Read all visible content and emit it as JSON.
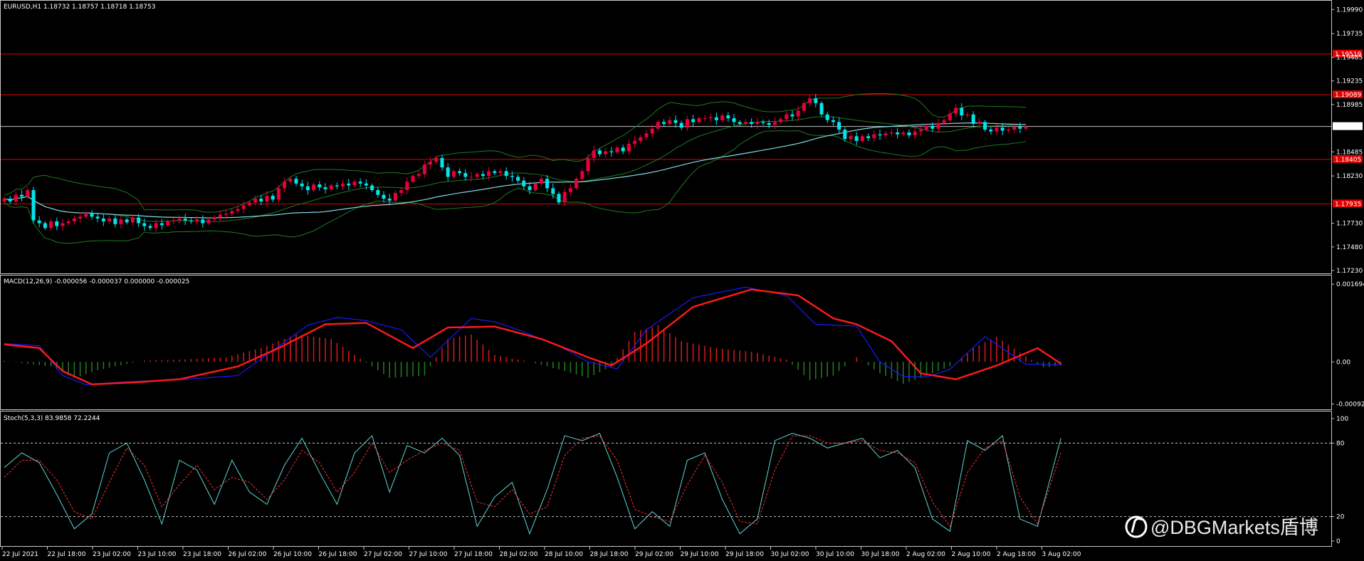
{
  "symbol_header": "EURUSD,H1  1.18732 1.18757 1.18718 1.18753",
  "watermark": "@DBGMarkets盾博",
  "colors": {
    "background": "#000000",
    "frame": "#c8c8c8",
    "bull_candle": "#e8003d",
    "bear_candle": "#00e5ee",
    "bollinger": "#1f7a1f",
    "moving_average": "#7fdbe8",
    "level_line": "#e00000",
    "bid_line": "#c0c0c0",
    "macd_line": "#1a1aff",
    "signal_line": "#ff1a1a",
    "hist_pos": "#cc1a1a",
    "hist_neg": "#1f7a1f",
    "stoch_main": "#5fd5d5",
    "stoch_signal": "#ff3030"
  },
  "chart_data": [
    {
      "type": "candlestick",
      "title": "EURUSD,H1  1.18732 1.18757 1.18718 1.18753",
      "price_ticks": [
        "1.19990",
        "1.19735",
        "1.19485",
        "1.19235",
        "1.18985",
        "1.18485",
        "1.18230",
        "1.17730",
        "1.17480",
        "1.17230"
      ],
      "y_range": [
        1.1723,
        1.2006
      ],
      "current_price": "1.18753",
      "level_labels": [
        "1.19519",
        "1.19089",
        "1.18405",
        "1.17935"
      ],
      "levels": [
        1.19519,
        1.19089,
        1.18405,
        1.17935
      ],
      "closes": [
        1.1799,
        1.1796,
        1.1803,
        1.1801,
        1.1808,
        1.1776,
        1.1773,
        1.1768,
        1.1775,
        1.177,
        1.1773,
        1.1775,
        1.1778,
        1.178,
        1.1784,
        1.178,
        1.1778,
        1.1775,
        1.1778,
        1.1772,
        1.1777,
        1.1774,
        1.1779,
        1.1773,
        1.177,
        1.1768,
        1.1773,
        1.1771,
        1.1775,
        1.1776,
        1.1778,
        1.1776,
        1.1775,
        1.1777,
        1.1773,
        1.1777,
        1.1779,
        1.1782,
        1.1783,
        1.1786,
        1.1788,
        1.1792,
        1.1795,
        1.1799,
        1.1796,
        1.1802,
        1.1798,
        1.181,
        1.1817,
        1.182,
        1.1815,
        1.1812,
        1.1808,
        1.1814,
        1.1811,
        1.1809,
        1.1813,
        1.1812,
        1.1815,
        1.1813,
        1.1817,
        1.1815,
        1.1813,
        1.1808,
        1.1803,
        1.1799,
        1.1797,
        1.1805,
        1.1808,
        1.1817,
        1.1823,
        1.1825,
        1.1835,
        1.1838,
        1.1842,
        1.1832,
        1.1822,
        1.1828,
        1.1826,
        1.1822,
        1.1822,
        1.1825,
        1.1823,
        1.1828,
        1.1826,
        1.1828,
        1.1823,
        1.1822,
        1.1818,
        1.1812,
        1.1808,
        1.1815,
        1.182,
        1.181,
        1.1804,
        1.1795,
        1.1806,
        1.181,
        1.182,
        1.1828,
        1.1842,
        1.185,
        1.1846,
        1.1849,
        1.1848,
        1.1853,
        1.1849,
        1.1857,
        1.186,
        1.1864,
        1.1868,
        1.1873,
        1.188,
        1.1878,
        1.1882,
        1.1879,
        1.1874,
        1.1883,
        1.188,
        1.1884,
        1.1884,
        1.1885,
        1.1882,
        1.1887,
        1.1884,
        1.188,
        1.1878,
        1.188,
        1.1878,
        1.188,
        1.1879,
        1.1877,
        1.188,
        1.1883,
        1.1888,
        1.1886,
        1.1892,
        1.19,
        1.1905,
        1.19,
        1.1888,
        1.1882,
        1.188,
        1.1872,
        1.1862,
        1.1865,
        1.186,
        1.1865,
        1.1863,
        1.1867,
        1.1866,
        1.1868,
        1.1869,
        1.1867,
        1.1869,
        1.1866,
        1.187,
        1.1872,
        1.1876,
        1.1873,
        1.1879,
        1.1882,
        1.1889,
        1.1895,
        1.1887,
        1.1888,
        1.1878,
        1.188,
        1.1872,
        1.187,
        1.1874,
        1.1871,
        1.1872,
        1.1875,
        1.1873,
        1.18753
      ],
      "x_ticks": [
        "22 Jul 2021",
        "22 Jul 18:00",
        "23 Jul 02:00",
        "23 Jul 10:00",
        "23 Jul 18:00",
        "26 Jul 02:00",
        "26 Jul 10:00",
        "26 Jul 18:00",
        "27 Jul 02:00",
        "27 Jul 10:00",
        "27 Jul 18:00",
        "28 Jul 02:00",
        "28 Jul 10:00",
        "28 Jul 18:00",
        "29 Jul 02:00",
        "29 Jul 10:00",
        "29 Jul 18:00",
        "30 Jul 02:00",
        "30 Jul 10:00",
        "30 Jul 18:00",
        "2 Aug 02:00",
        "2 Aug 10:00",
        "2 Aug 18:00",
        "3 Aug 02:00"
      ]
    },
    {
      "type": "line",
      "title": "MACD(12,26,9) -0.000056 -0.000037 0.000000 -0.000025",
      "y_ticks": [
        "0.001694",
        "0.00",
        "-0.00092"
      ],
      "y_range": [
        -0.00099,
        0.00176
      ],
      "series": [
        {
          "role": "macd",
          "kind": "line",
          "x": [
            0,
            6,
            10,
            14,
            20,
            30,
            40,
            52,
            57,
            62,
            68,
            73,
            80,
            84,
            87,
            90,
            95,
            100,
            105,
            110,
            118,
            127,
            134,
            139,
            146,
            150,
            154,
            158,
            162,
            168,
            175,
            181
          ],
          "y": [
            0.0004,
            0.00035,
            -0.0003,
            -0.0005,
            -0.00044,
            -0.00039,
            -0.0003,
            0.0008,
            0.00097,
            0.0009,
            0.0007,
            0.0001,
            0.00095,
            0.00087,
            0.00075,
            0.0006,
            0.00035,
            0.0,
            -0.00015,
            0.0007,
            0.0014,
            0.00163,
            0.00145,
            0.00082,
            0.00078,
            0.0,
            -0.00032,
            -0.00033,
            -0.00016,
            0.00055,
            -5e-05,
            -6e-05
          ]
        },
        {
          "role": "signal",
          "kind": "line",
          "x": [
            0,
            6,
            10,
            15,
            22,
            30,
            40,
            47,
            55,
            62,
            70,
            76,
            84,
            92,
            100,
            104,
            110,
            118,
            128,
            136,
            142,
            146,
            152,
            157,
            163,
            170,
            177,
            181
          ],
          "y": [
            0.00038,
            0.0003,
            -0.0002,
            -0.00049,
            -0.00045,
            -0.00038,
            -0.0001,
            0.0003,
            0.00082,
            0.00085,
            0.0003,
            0.00075,
            0.00077,
            0.0005,
            0.0001,
            -8e-05,
            0.0004,
            0.0012,
            0.00158,
            0.00145,
            0.00095,
            0.00082,
            0.00045,
            -0.00025,
            -0.00038,
            -8e-05,
            0.0003,
            -4e-05
          ]
        },
        {
          "role": "histogram",
          "kind": "bars",
          "x": [
            0,
            8,
            12,
            16,
            24,
            30,
            38,
            44,
            50,
            56,
            60,
            66,
            72,
            76,
            80,
            84,
            90,
            96,
            100,
            104,
            108,
            112,
            116,
            122,
            128,
            134,
            138,
            142,
            146,
            150,
            154,
            158,
            162,
            166,
            170,
            174,
            178,
            181
          ],
          "y": [
            2e-05,
            -0.0001,
            -0.00035,
            -0.00018,
            3e-05,
            5e-05,
            0.0001,
            0.0003,
            0.0006,
            0.0005,
            0.00015,
            -0.00035,
            -0.0003,
            0.0005,
            0.0006,
            0.00015,
            0.0,
            -0.0002,
            -0.00035,
            -0.0001,
            0.00065,
            0.0008,
            0.00045,
            0.0003,
            0.00022,
            5e-05,
            -0.0004,
            -0.0003,
            0.0001,
            -0.00025,
            -0.00048,
            -0.0003,
            -0.0001,
            0.0003,
            0.00055,
            0.0002,
            -0.00012,
            -8e-05
          ]
        }
      ]
    },
    {
      "type": "line",
      "title": "Stoch(5,3,3) 83.9858 72.2244",
      "y_ticks": [
        "100",
        "80",
        "20",
        "0"
      ],
      "y_range": [
        0,
        100
      ],
      "levels": [
        80,
        20
      ],
      "series": [
        {
          "role": "main",
          "x": [
            0,
            3,
            6,
            9,
            12,
            15,
            18,
            21,
            24,
            27,
            30,
            33,
            36,
            39,
            42,
            45,
            48,
            51,
            54,
            57,
            60,
            63,
            66,
            69,
            72,
            75,
            78,
            81,
            84,
            87,
            90,
            93,
            96,
            99,
            102,
            105,
            108,
            111,
            114,
            117,
            120,
            123,
            126,
            129,
            132,
            135,
            138,
            141,
            144,
            147,
            150,
            153,
            156,
            159,
            162,
            165,
            168,
            171,
            174,
            177,
            181
          ],
          "y": [
            60,
            72,
            64,
            38,
            10,
            22,
            72,
            80,
            50,
            14,
            66,
            58,
            30,
            66,
            40,
            30,
            62,
            84,
            56,
            30,
            72,
            86,
            40,
            78,
            72,
            84,
            70,
            12,
            36,
            48,
            6,
            42,
            86,
            82,
            88,
            52,
            10,
            24,
            12,
            66,
            72,
            34,
            6,
            18,
            82,
            88,
            84,
            76,
            80,
            84,
            68,
            74,
            60,
            18,
            8,
            82,
            74,
            86,
            18,
            12,
            84
          ]
        },
        {
          "role": "signal",
          "x": [
            0,
            3,
            6,
            9,
            12,
            15,
            18,
            21,
            24,
            27,
            30,
            33,
            36,
            39,
            42,
            45,
            48,
            51,
            54,
            57,
            60,
            63,
            66,
            69,
            72,
            75,
            78,
            81,
            84,
            87,
            90,
            93,
            96,
            99,
            102,
            105,
            108,
            111,
            114,
            117,
            120,
            123,
            126,
            129,
            132,
            135,
            138,
            141,
            144,
            147,
            150,
            153,
            156,
            159,
            162,
            165,
            168,
            171,
            174,
            177,
            181
          ],
          "y": [
            52,
            66,
            66,
            50,
            24,
            18,
            48,
            76,
            62,
            28,
            46,
            62,
            42,
            52,
            48,
            34,
            50,
            74,
            64,
            40,
            56,
            80,
            56,
            66,
            74,
            80,
            74,
            32,
            28,
            42,
            22,
            28,
            70,
            84,
            86,
            66,
            26,
            20,
            16,
            46,
            70,
            48,
            16,
            14,
            58,
            86,
            86,
            80,
            80,
            82,
            74,
            72,
            64,
            32,
            12,
            56,
            76,
            82,
            36,
            14,
            72
          ]
        }
      ]
    }
  ]
}
